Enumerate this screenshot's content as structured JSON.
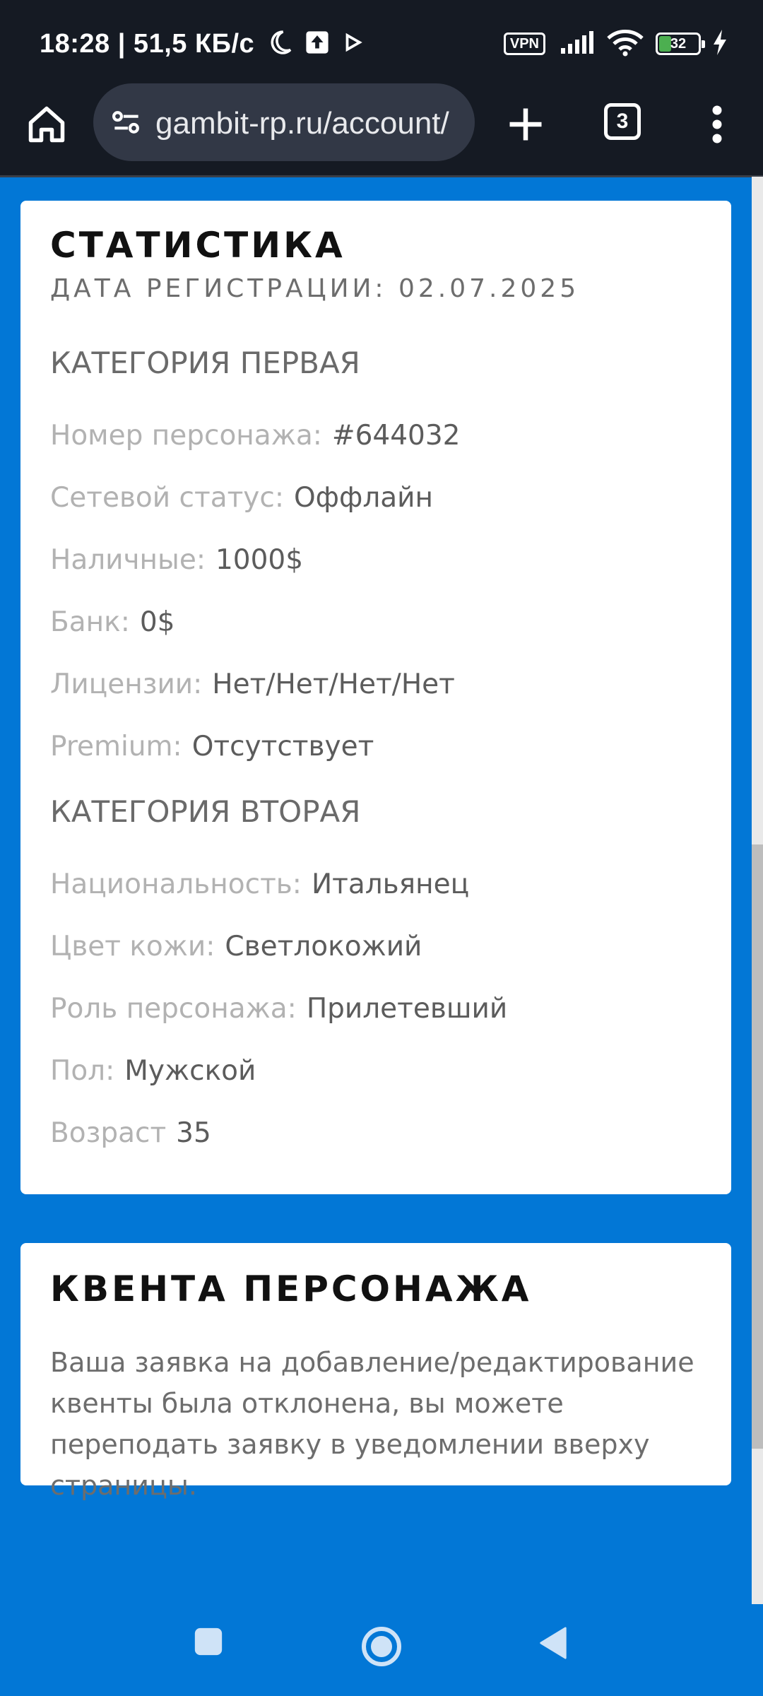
{
  "status_bar": {
    "left_text": "18:28 | 51,5 КБ/с",
    "vpn_label": "VPN",
    "battery_percent": "32",
    "battery_level": 0.32
  },
  "browser": {
    "url": "gambit-rp.ru/account/",
    "tab_count": "3"
  },
  "stats_card": {
    "title": "СТАТИСТИКА",
    "registration": "ДАТА РЕГИСТРАЦИИ: 02.07.2025",
    "category1": {
      "title": "КАТЕГОРИЯ ПЕРВАЯ",
      "rows": [
        {
          "label": "Номер персонажа:",
          "value": "#644032"
        },
        {
          "label": "Сетевой статус:",
          "value": "Оффлайн"
        },
        {
          "label": "Наличные:",
          "value": "1000$"
        },
        {
          "label": "Банк:",
          "value": "0$"
        },
        {
          "label": "Лицензии:",
          "value": "Нет/Нет/Нет/Нет"
        },
        {
          "label": "Premium:",
          "value": "Отсутствует"
        }
      ]
    },
    "category2": {
      "title": "КАТЕГОРИЯ ВТОРАЯ",
      "rows": [
        {
          "label": "Национальность:",
          "value": "Итальянец"
        },
        {
          "label": "Цвет кожи:",
          "value": "Светлокожий"
        },
        {
          "label": "Роль персонажа:",
          "value": "Прилетевший"
        },
        {
          "label": "Пол:",
          "value": "Мужской"
        },
        {
          "label": "Возраст",
          "value": "35"
        }
      ]
    }
  },
  "quenta_card": {
    "title": "КВЕНТА ПЕРСОНАЖА",
    "text": "Ваша заявка на добавление/редактирование квенты была отклонена, вы можете переподать заявку в уведомлении вверху страницы."
  },
  "colors": {
    "page_background": "#0277d6",
    "system_bar": "#151a23",
    "url_bar": "#323846",
    "battery_fill": "#4caf50"
  },
  "icons": {
    "status_bar": [
      "moon-icon",
      "upload-icon",
      "play-icon",
      "signal-icon",
      "wifi-icon",
      "charging-icon"
    ],
    "toolbar": [
      "home-icon",
      "site-settings-icon",
      "plus-icon",
      "more-vert-icon"
    ],
    "nav": [
      "recents-icon",
      "home-circle-icon",
      "back-icon"
    ]
  }
}
